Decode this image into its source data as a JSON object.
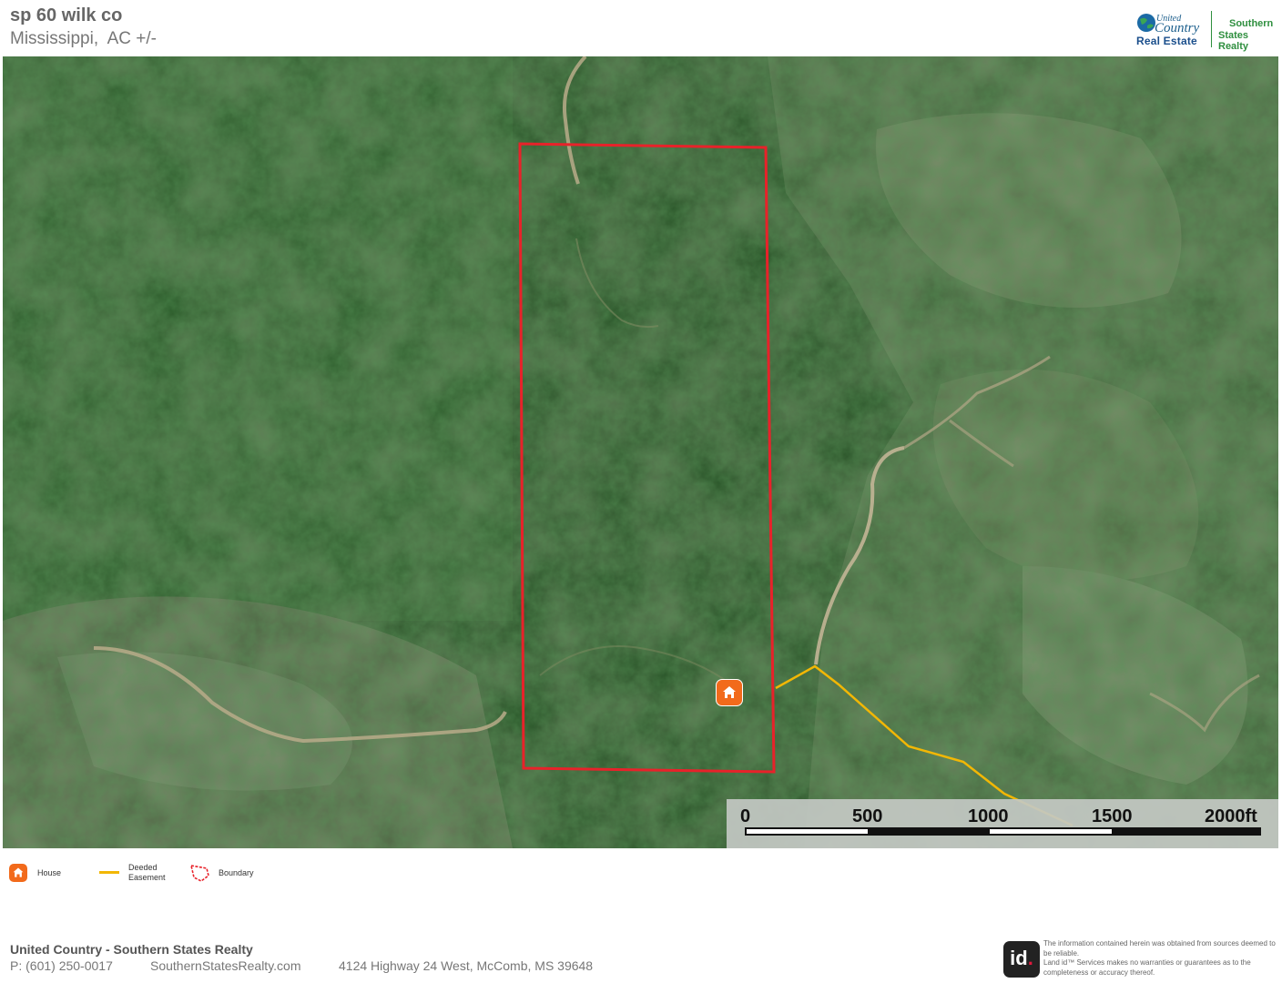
{
  "header": {
    "title": "sp 60 wilk co",
    "subtitle": "Mississippi,  AC +/-"
  },
  "logo": {
    "united": "United",
    "country": "Country",
    "real_estate": "Real Estate",
    "brand_line1": "Southern",
    "brand_line2": "States Realty"
  },
  "map": {
    "imagery": "satellite",
    "boundary_color": "#e8222a",
    "easement_color": "#f2b705",
    "house_marker_icon": "house-icon",
    "scale": {
      "labels": [
        "0",
        "500",
        "1000",
        "1500",
        "2000ft"
      ],
      "unit": "ft"
    }
  },
  "legend": {
    "items": [
      {
        "icon": "house-icon",
        "label": "House"
      },
      {
        "icon": "easement-line-icon",
        "label_line1": "Deeded",
        "label_line2": "Easement"
      },
      {
        "icon": "boundary-polygon-icon",
        "label": "Boundary"
      }
    ]
  },
  "footer": {
    "company": "United Country - Southern States Realty",
    "phone": "P: (601) 250-0017",
    "website": "SouthernStatesRealty.com",
    "address": "4124 Highway 24 West, McComb, MS 39648",
    "id_logo_text": "id",
    "disclaimer_line1": "The information contained herein was obtained from sources deemed to be reliable.",
    "disclaimer_line2": "Land id™ Services makes no warranties or guarantees as to the completeness or accuracy thereof."
  }
}
